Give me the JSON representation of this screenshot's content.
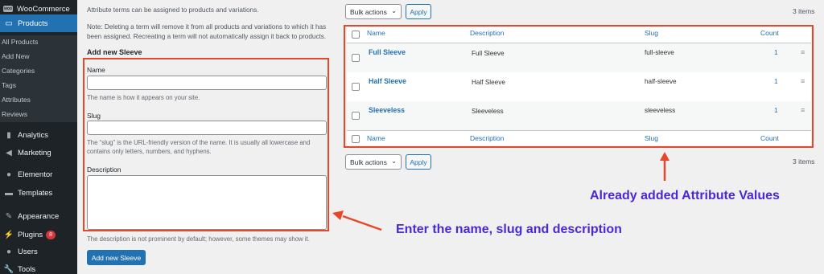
{
  "sidebar": {
    "items": [
      {
        "label": "WooCommerce",
        "icon": "woocommerce-icon"
      },
      {
        "label": "Products",
        "icon": "products-icon"
      },
      {
        "label": "Analytics",
        "icon": "analytics-icon"
      },
      {
        "label": "Marketing",
        "icon": "megaphone-icon"
      },
      {
        "label": "Elementor",
        "icon": "elementor-icon"
      },
      {
        "label": "Templates",
        "icon": "folder-icon"
      },
      {
        "label": "Appearance",
        "icon": "paintbrush-icon"
      },
      {
        "label": "Plugins",
        "icon": "plugin-icon",
        "badge": "8"
      },
      {
        "label": "Users",
        "icon": "user-icon"
      },
      {
        "label": "Tools",
        "icon": "wrench-icon"
      }
    ],
    "submenu": [
      "All Products",
      "Add New",
      "Categories",
      "Tags",
      "Attributes",
      "Reviews"
    ],
    "woo_badge_text": "woo"
  },
  "form": {
    "intro": "Attribute terms can be assigned to products and variations.",
    "note_line1": "Note: Deleting a term will remove it from all products and variations to which it has",
    "note_line2": "been assigned. Recreating a term will not automatically assign it back to products.",
    "heading": "Add new Sleeve",
    "name_label": "Name",
    "name_value": "",
    "name_hint": "The name is how it appears on your site.",
    "slug_label": "Slug",
    "slug_value": "",
    "slug_hint_line1": "The “slug” is the URL-friendly version of the name. It is usually all lowercase and",
    "slug_hint_line2": "contains only letters, numbers, and hyphens.",
    "description_label": "Description",
    "description_value": "",
    "description_hint": "The description is not prominent by default; however, some themes may show it.",
    "submit_label": "Add new Sleeve"
  },
  "table": {
    "bulk_actions_label": "Bulk actions",
    "apply_label": "Apply",
    "items_count": "3 items",
    "columns": [
      "Name",
      "Description",
      "Slug",
      "Count"
    ],
    "rows": [
      {
        "name": "Full Sleeve",
        "description": "Full Sleeve",
        "slug": "full-sleeve",
        "count": "1"
      },
      {
        "name": "Half Sleeve",
        "description": "Half Sleeve",
        "slug": "half-sleeve",
        "count": "1"
      },
      {
        "name": "Sleeveless",
        "description": "Sleeveless",
        "slug": "sleeveless",
        "count": "1"
      }
    ]
  },
  "annotations": {
    "table_caption": "Already added Attribute Values",
    "form_caption": "Enter the name, slug and description"
  },
  "colors": {
    "sidebar_bg": "#1d2327",
    "accent": "#2271b1",
    "highlight_box": "#e8462a",
    "annotation_text": "#4a28d6"
  }
}
